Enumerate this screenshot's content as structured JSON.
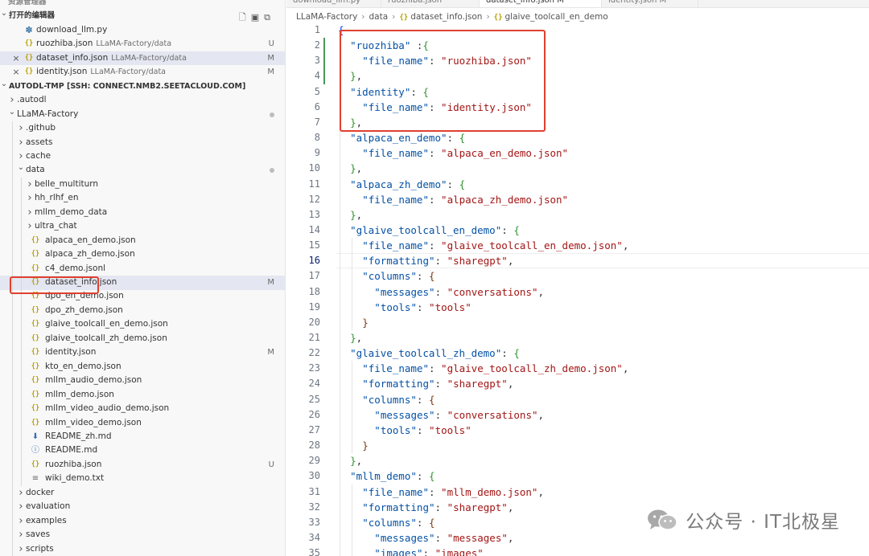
{
  "sidebar": {
    "top_cut_label": "资源管理器",
    "open_editors": {
      "title": "打开的编辑器",
      "items": [
        {
          "name": "download_llm.py",
          "type": "py",
          "hint": "",
          "badge": "",
          "closable": false
        },
        {
          "name": "ruozhiba.json",
          "type": "json",
          "hint": "LLaMA-Factory/data",
          "badge": "U",
          "closable": false
        },
        {
          "name": "dataset_info.json",
          "type": "json",
          "hint": "LLaMA-Factory/data",
          "badge": "M",
          "closable": true
        },
        {
          "name": "identity.json",
          "type": "json",
          "hint": "LLaMA-Factory/data",
          "badge": "M",
          "closable": true
        }
      ]
    },
    "workspace": {
      "title": "AUTODL-TMP [SSH: CONNECT.NMB2.SEETACLOUD.COM]",
      "tree": [
        {
          "name": ".autodl",
          "kind": "folder",
          "expanded": false,
          "depth": 0
        },
        {
          "name": "LLaMA-Factory",
          "kind": "folder",
          "expanded": true,
          "depth": 0,
          "dot": true
        },
        {
          "name": ".github",
          "kind": "folder",
          "expanded": false,
          "depth": 1
        },
        {
          "name": "assets",
          "kind": "folder",
          "expanded": false,
          "depth": 1
        },
        {
          "name": "cache",
          "kind": "folder",
          "expanded": false,
          "depth": 1
        },
        {
          "name": "data",
          "kind": "folder",
          "expanded": true,
          "depth": 1,
          "dot": true
        },
        {
          "name": "belle_multiturn",
          "kind": "folder",
          "expanded": false,
          "depth": 2
        },
        {
          "name": "hh_rlhf_en",
          "kind": "folder",
          "expanded": false,
          "depth": 2
        },
        {
          "name": "mllm_demo_data",
          "kind": "folder",
          "expanded": false,
          "depth": 2
        },
        {
          "name": "ultra_chat",
          "kind": "folder",
          "expanded": false,
          "depth": 2
        },
        {
          "name": "alpaca_en_demo.json",
          "kind": "json",
          "depth": 2
        },
        {
          "name": "alpaca_zh_demo.json",
          "kind": "json",
          "depth": 2
        },
        {
          "name": "c4_demo.jsonl",
          "kind": "json",
          "depth": 2
        },
        {
          "name": "dataset_info.json",
          "kind": "json",
          "depth": 2,
          "badge": "M",
          "selected": true
        },
        {
          "name": "dpo_en_demo.json",
          "kind": "json",
          "depth": 2
        },
        {
          "name": "dpo_zh_demo.json",
          "kind": "json",
          "depth": 2
        },
        {
          "name": "glaive_toolcall_en_demo.json",
          "kind": "json",
          "depth": 2
        },
        {
          "name": "glaive_toolcall_zh_demo.json",
          "kind": "json",
          "depth": 2
        },
        {
          "name": "identity.json",
          "kind": "json",
          "depth": 2,
          "badge": "M"
        },
        {
          "name": "kto_en_demo.json",
          "kind": "json",
          "depth": 2
        },
        {
          "name": "mllm_audio_demo.json",
          "kind": "json",
          "depth": 2
        },
        {
          "name": "mllm_demo.json",
          "kind": "json",
          "depth": 2
        },
        {
          "name": "mllm_video_audio_demo.json",
          "kind": "json",
          "depth": 2
        },
        {
          "name": "mllm_video_demo.json",
          "kind": "json",
          "depth": 2
        },
        {
          "name": "README_zh.md",
          "kind": "md",
          "depth": 2
        },
        {
          "name": "README.md",
          "kind": "info",
          "depth": 2
        },
        {
          "name": "ruozhiba.json",
          "kind": "json",
          "depth": 2,
          "badge": "U"
        },
        {
          "name": "wiki_demo.txt",
          "kind": "txt",
          "depth": 2
        },
        {
          "name": "docker",
          "kind": "folder",
          "expanded": false,
          "depth": 1
        },
        {
          "name": "evaluation",
          "kind": "folder",
          "expanded": false,
          "depth": 1
        },
        {
          "name": "examples",
          "kind": "folder",
          "expanded": false,
          "depth": 1
        },
        {
          "name": "saves",
          "kind": "folder",
          "expanded": false,
          "depth": 1
        },
        {
          "name": "scripts",
          "kind": "folder",
          "expanded": false,
          "depth": 1
        }
      ]
    }
  },
  "editor": {
    "tabs": [
      {
        "label": "download_llm.py",
        "active": false
      },
      {
        "label": "ruozhiba.json",
        "active": false
      },
      {
        "label": "dataset_info.json  M",
        "active": true
      },
      {
        "label": "identity.json  M",
        "active": false
      }
    ],
    "breadcrumb": [
      "LLaMA-Factory",
      "data",
      "dataset_info.json",
      "glaive_toolcall_en_demo"
    ],
    "current_line": 16,
    "lines": [
      [
        [
          "b1",
          "{"
        ]
      ],
      [
        [
          "k",
          "\"ruozhiba\""
        ],
        [
          "p",
          " :"
        ],
        [
          "b2",
          "{"
        ]
      ],
      [
        [
          "k",
          "\"file_name\""
        ],
        [
          "p",
          ": "
        ],
        [
          "s",
          "\"ruozhiba.json\""
        ]
      ],
      [
        [
          "b2",
          "}"
        ],
        [
          "p",
          ","
        ]
      ],
      [
        [
          "k",
          "\"identity\""
        ],
        [
          "p",
          ": "
        ],
        [
          "b2",
          "{"
        ]
      ],
      [
        [
          "k",
          "\"file_name\""
        ],
        [
          "p",
          ": "
        ],
        [
          "s",
          "\"identity.json\""
        ]
      ],
      [
        [
          "b2",
          "}"
        ],
        [
          "p",
          ","
        ]
      ],
      [
        [
          "k",
          "\"alpaca_en_demo\""
        ],
        [
          "p",
          ": "
        ],
        [
          "b2",
          "{"
        ]
      ],
      [
        [
          "k",
          "\"file_name\""
        ],
        [
          "p",
          ": "
        ],
        [
          "s",
          "\"alpaca_en_demo.json\""
        ]
      ],
      [
        [
          "b2",
          "}"
        ],
        [
          "p",
          ","
        ]
      ],
      [
        [
          "k",
          "\"alpaca_zh_demo\""
        ],
        [
          "p",
          ": "
        ],
        [
          "b2",
          "{"
        ]
      ],
      [
        [
          "k",
          "\"file_name\""
        ],
        [
          "p",
          ": "
        ],
        [
          "s",
          "\"alpaca_zh_demo.json\""
        ]
      ],
      [
        [
          "b2",
          "}"
        ],
        [
          "p",
          ","
        ]
      ],
      [
        [
          "k",
          "\"glaive_toolcall_en_demo\""
        ],
        [
          "p",
          ": "
        ],
        [
          "b2",
          "{"
        ]
      ],
      [
        [
          "k",
          "\"file_name\""
        ],
        [
          "p",
          ": "
        ],
        [
          "s",
          "\"glaive_toolcall_en_demo.json\""
        ],
        [
          "p",
          ","
        ]
      ],
      [
        [
          "k",
          "\"formatting\""
        ],
        [
          "p",
          ": "
        ],
        [
          "s",
          "\"sharegpt\""
        ],
        [
          "p",
          ","
        ]
      ],
      [
        [
          "k",
          "\"columns\""
        ],
        [
          "p",
          ": "
        ],
        [
          "b3",
          "{"
        ]
      ],
      [
        [
          "k",
          "\"messages\""
        ],
        [
          "p",
          ": "
        ],
        [
          "s",
          "\"conversations\""
        ],
        [
          "p",
          ","
        ]
      ],
      [
        [
          "k",
          "\"tools\""
        ],
        [
          "p",
          ": "
        ],
        [
          "s",
          "\"tools\""
        ]
      ],
      [
        [
          "b3",
          "}"
        ]
      ],
      [
        [
          "b2",
          "}"
        ],
        [
          "p",
          ","
        ]
      ],
      [
        [
          "k",
          "\"glaive_toolcall_zh_demo\""
        ],
        [
          "p",
          ": "
        ],
        [
          "b2",
          "{"
        ]
      ],
      [
        [
          "k",
          "\"file_name\""
        ],
        [
          "p",
          ": "
        ],
        [
          "s",
          "\"glaive_toolcall_zh_demo.json\""
        ],
        [
          "p",
          ","
        ]
      ],
      [
        [
          "k",
          "\"formatting\""
        ],
        [
          "p",
          ": "
        ],
        [
          "s",
          "\"sharegpt\""
        ],
        [
          "p",
          ","
        ]
      ],
      [
        [
          "k",
          "\"columns\""
        ],
        [
          "p",
          ": "
        ],
        [
          "b3",
          "{"
        ]
      ],
      [
        [
          "k",
          "\"messages\""
        ],
        [
          "p",
          ": "
        ],
        [
          "s",
          "\"conversations\""
        ],
        [
          "p",
          ","
        ]
      ],
      [
        [
          "k",
          "\"tools\""
        ],
        [
          "p",
          ": "
        ],
        [
          "s",
          "\"tools\""
        ]
      ],
      [
        [
          "b3",
          "}"
        ]
      ],
      [
        [
          "b2",
          "}"
        ],
        [
          "p",
          ","
        ]
      ],
      [
        [
          "k",
          "\"mllm_demo\""
        ],
        [
          "p",
          ": "
        ],
        [
          "b2",
          "{"
        ]
      ],
      [
        [
          "k",
          "\"file_name\""
        ],
        [
          "p",
          ": "
        ],
        [
          "s",
          "\"mllm_demo.json\""
        ],
        [
          "p",
          ","
        ]
      ],
      [
        [
          "k",
          "\"formatting\""
        ],
        [
          "p",
          ": "
        ],
        [
          "s",
          "\"sharegpt\""
        ],
        [
          "p",
          ","
        ]
      ],
      [
        [
          "k",
          "\"columns\""
        ],
        [
          "p",
          ": "
        ],
        [
          "b3",
          "{"
        ]
      ],
      [
        [
          "k",
          "\"messages\""
        ],
        [
          "p",
          ": "
        ],
        [
          "s",
          "\"messages\""
        ],
        [
          "p",
          ","
        ]
      ],
      [
        [
          "k",
          "\"images\""
        ],
        [
          "p",
          ": "
        ],
        [
          "s",
          "\"images\""
        ]
      ]
    ],
    "indents": [
      0,
      1,
      2,
      1,
      1,
      2,
      1,
      1,
      2,
      1,
      1,
      2,
      1,
      1,
      2,
      2,
      2,
      3,
      3,
      2,
      1,
      1,
      2,
      2,
      2,
      3,
      3,
      2,
      1,
      1,
      2,
      2,
      2,
      3,
      3
    ]
  },
  "watermark": {
    "text": "公众号 · IT北极星",
    "icon": "wechat-icon"
  },
  "colors": {
    "highlight": "#e0402f",
    "selection": "#e4e6f1",
    "gutter_modified": "#48985d"
  }
}
